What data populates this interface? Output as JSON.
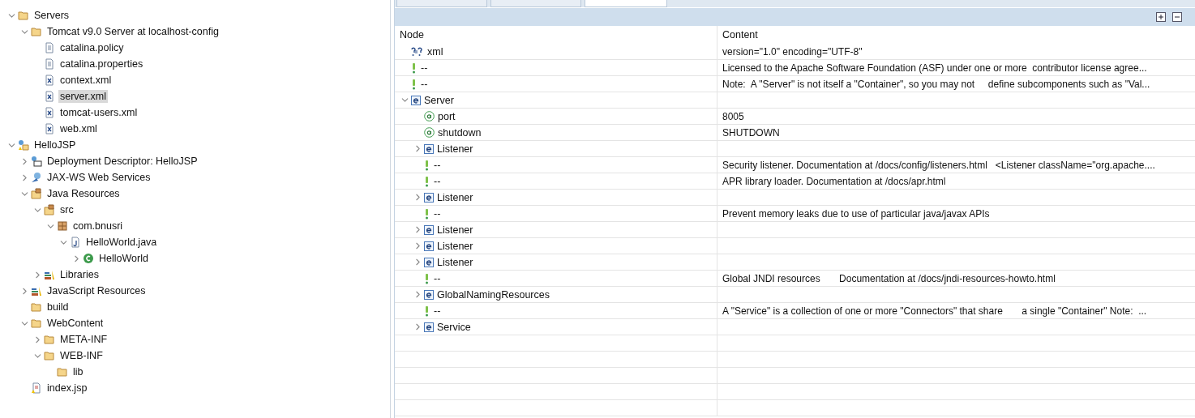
{
  "explorer": {
    "tree": [
      {
        "label": "Servers",
        "kind": "folder",
        "expanded": true,
        "selected": false,
        "children": [
          {
            "label": "Tomcat v9.0 Server at localhost-config",
            "kind": "folder",
            "expanded": true,
            "selected": false,
            "children": [
              {
                "label": "catalina.policy",
                "kind": "text-file",
                "selected": false
              },
              {
                "label": "catalina.properties",
                "kind": "text-file",
                "selected": false
              },
              {
                "label": "context.xml",
                "kind": "xml-file",
                "selected": false
              },
              {
                "label": "server.xml",
                "kind": "xml-file",
                "selected": true
              },
              {
                "label": "tomcat-users.xml",
                "kind": "xml-file",
                "selected": false
              },
              {
                "label": "web.xml",
                "kind": "xml-file",
                "selected": false
              }
            ]
          }
        ]
      },
      {
        "label": "HelloJSP",
        "kind": "project",
        "expanded": true,
        "selected": false,
        "children": [
          {
            "label": "Deployment Descriptor: HelloJSP",
            "kind": "descriptor",
            "expanded": false,
            "selected": false
          },
          {
            "label": "JAX-WS Web Services",
            "kind": "webservice",
            "expanded": false,
            "selected": false
          },
          {
            "label": "Java Resources",
            "kind": "source-folder",
            "expanded": true,
            "selected": false,
            "children": [
              {
                "label": "src",
                "kind": "source-folder",
                "expanded": true,
                "selected": false,
                "children": [
                  {
                    "label": "com.bnusri",
                    "kind": "package",
                    "expanded": true,
                    "selected": false,
                    "children": [
                      {
                        "label": "HelloWorld.java",
                        "kind": "java-file",
                        "expanded": true,
                        "selected": false,
                        "children": [
                          {
                            "label": "HelloWorld",
                            "kind": "class",
                            "expanded": false,
                            "selected": false
                          }
                        ]
                      }
                    ]
                  }
                ]
              },
              {
                "label": "Libraries",
                "kind": "library",
                "expanded": false,
                "selected": false
              }
            ]
          },
          {
            "label": "JavaScript Resources",
            "kind": "library",
            "expanded": false,
            "selected": false
          },
          {
            "label": "build",
            "kind": "folder",
            "selected": false
          },
          {
            "label": "WebContent",
            "kind": "folder",
            "expanded": true,
            "selected": false,
            "children": [
              {
                "label": "META-INF",
                "kind": "folder",
                "expanded": false,
                "selected": false
              },
              {
                "label": "WEB-INF",
                "kind": "folder",
                "expanded": true,
                "selected": false,
                "children": [
                  {
                    "label": "lib",
                    "kind": "folder",
                    "selected": false
                  }
                ]
              }
            ]
          },
          {
            "label": "index.jsp",
            "kind": "jsp-file",
            "selected": false
          }
        ]
      }
    ]
  },
  "editor": {
    "tabs": [
      {
        "selected": false
      },
      {
        "selected": false
      },
      {
        "selected": true
      }
    ],
    "columns": [
      "Node",
      "Content"
    ],
    "nodes": [
      {
        "kind": "instruction",
        "name": "xml",
        "content": "version=\"1.0\" encoding=\"UTF-8\""
      },
      {
        "kind": "comment",
        "name": "--",
        "content": "Licensed to the Apache Software Foundation (ASF) under one or more  contributor license agree..."
      },
      {
        "kind": "comment",
        "name": "--",
        "content": "Note:  A \"Server\" is not itself a \"Container\", so you may not     define subcomponents such as \"Val..."
      },
      {
        "kind": "element",
        "name": "Server",
        "expanded": true,
        "children": [
          {
            "kind": "attribute",
            "name": "port",
            "content": "8005"
          },
          {
            "kind": "attribute",
            "name": "shutdown",
            "content": "SHUTDOWN"
          },
          {
            "kind": "element",
            "name": "Listener",
            "expanded": false
          },
          {
            "kind": "comment",
            "name": "--",
            "content": "Security listener. Documentation at /docs/config/listeners.html   <Listener className=\"org.apache...."
          },
          {
            "kind": "comment",
            "name": "--",
            "content": "APR library loader. Documentation at /docs/apr.html"
          },
          {
            "kind": "element",
            "name": "Listener",
            "expanded": false
          },
          {
            "kind": "comment",
            "name": "--",
            "content": "Prevent memory leaks due to use of particular java/javax APIs"
          },
          {
            "kind": "element",
            "name": "Listener",
            "expanded": false
          },
          {
            "kind": "element",
            "name": "Listener",
            "expanded": false
          },
          {
            "kind": "element",
            "name": "Listener",
            "expanded": false
          },
          {
            "kind": "comment",
            "name": "--",
            "content": "Global JNDI resources       Documentation at /docs/jndi-resources-howto.html"
          },
          {
            "kind": "element",
            "name": "GlobalNamingResources",
            "expanded": false
          },
          {
            "kind": "comment",
            "name": "--",
            "content": "A \"Service\" is a collection of one or more \"Connectors\" that share       a single \"Container\" Note:  ..."
          },
          {
            "kind": "element",
            "name": "Service",
            "expanded": false
          }
        ]
      }
    ]
  }
}
